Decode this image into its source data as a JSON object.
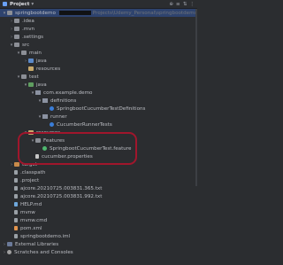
{
  "header": {
    "title": "Project",
    "chevron": "▾",
    "tools": [
      "⊕",
      "≡",
      "⇅",
      "⋮"
    ]
  },
  "project": {
    "root_name": "springbootdemo",
    "root_path": "Projects\\Udemy_Personal\\springbootdemo"
  },
  "tree": [
    {
      "id": "r0",
      "depth": 0,
      "arrow": "▾",
      "icon": "folder",
      "label": "springbootdemo",
      "color": "normal",
      "selected": true
    },
    {
      "id": "r1",
      "depth": 1,
      "arrow": "›",
      "icon": "folder",
      "label": ".idea",
      "color": "normal"
    },
    {
      "id": "r2",
      "depth": 1,
      "arrow": "›",
      "icon": "folder",
      "label": ".mvn",
      "color": "normal"
    },
    {
      "id": "r3",
      "depth": 1,
      "arrow": "›",
      "icon": "folder",
      "label": ".settings",
      "color": "normal"
    },
    {
      "id": "r4",
      "depth": 1,
      "arrow": "▾",
      "icon": "folder",
      "label": "src",
      "color": "normal"
    },
    {
      "id": "r5",
      "depth": 2,
      "arrow": "▾",
      "icon": "folder",
      "label": "main",
      "color": "normal"
    },
    {
      "id": "r6",
      "depth": 3,
      "arrow": "›",
      "icon": "folder src",
      "label": "java",
      "color": "normal"
    },
    {
      "id": "r7",
      "depth": 3,
      "arrow": "",
      "icon": "folder res",
      "label": "resources",
      "color": "normal"
    },
    {
      "id": "r8",
      "depth": 2,
      "arrow": "▾",
      "icon": "folder",
      "label": "test",
      "color": "normal"
    },
    {
      "id": "r9",
      "depth": 3,
      "arrow": "▾",
      "icon": "folder test",
      "label": "java",
      "color": "normal"
    },
    {
      "id": "r10",
      "depth": 4,
      "arrow": "▾",
      "icon": "pkg",
      "label": "com.example.demo",
      "color": "normal"
    },
    {
      "id": "r11",
      "depth": 5,
      "arrow": "▾",
      "icon": "pkg",
      "label": "definitions",
      "color": "normal"
    },
    {
      "id": "r12",
      "depth": 6,
      "arrow": "",
      "icon": "cls",
      "label": "SpringbootCucumberTestDefinitions",
      "color": "normal"
    },
    {
      "id": "r13",
      "depth": 5,
      "arrow": "▾",
      "icon": "pkg",
      "label": "runner",
      "color": "normal"
    },
    {
      "id": "r14",
      "depth": 6,
      "arrow": "",
      "icon": "cls",
      "label": "CucumberRunnerTests",
      "color": "normal"
    },
    {
      "id": "r15",
      "depth": 3,
      "arrow": "▾",
      "icon": "folder res",
      "label": "resources",
      "color": "normal"
    },
    {
      "id": "r16",
      "depth": 4,
      "arrow": "▾",
      "icon": "folder",
      "label": "Features",
      "color": "normal"
    },
    {
      "id": "r17",
      "depth": 5,
      "arrow": "",
      "icon": "feat",
      "label": "SpringbootCucumberTest.feature",
      "color": "normal"
    },
    {
      "id": "r18",
      "depth": 4,
      "arrow": "",
      "icon": "props",
      "label": "cucumber.properties",
      "color": "normal"
    },
    {
      "id": "r19",
      "depth": 1,
      "arrow": "›",
      "icon": "folder excl",
      "label": "target",
      "color": "normal"
    },
    {
      "id": "r20",
      "depth": 1,
      "arrow": "",
      "icon": "file",
      "label": ".classpath",
      "color": "normal"
    },
    {
      "id": "r21",
      "depth": 1,
      "arrow": "",
      "icon": "file",
      "label": ".project",
      "color": "normal"
    },
    {
      "id": "r22",
      "depth": 1,
      "arrow": "",
      "icon": "file",
      "label": "ajcore.20210725.003831.365.txt",
      "color": "normal"
    },
    {
      "id": "r23",
      "depth": 1,
      "arrow": "",
      "icon": "file",
      "label": "ajcore.20210725.003831.992.txt",
      "color": "normal"
    },
    {
      "id": "r24",
      "depth": 1,
      "arrow": "",
      "icon": "md",
      "label": "HELP.md",
      "color": "normal"
    },
    {
      "id": "r25",
      "depth": 1,
      "arrow": "",
      "icon": "file",
      "label": "mvnw",
      "color": "normal"
    },
    {
      "id": "r26",
      "depth": 1,
      "arrow": "",
      "icon": "file",
      "label": "mvnw.cmd",
      "color": "normal"
    },
    {
      "id": "r27",
      "depth": 1,
      "arrow": "",
      "icon": "xml",
      "label": "pom.xml",
      "color": "normal"
    },
    {
      "id": "r28",
      "depth": 1,
      "arrow": "",
      "icon": "file",
      "label": "springbootdemo.iml",
      "color": "normal"
    },
    {
      "id": "r29",
      "depth": 0,
      "arrow": "›",
      "icon": "lib",
      "label": "External Libraries",
      "color": "normal"
    },
    {
      "id": "r30",
      "depth": 0,
      "arrow": "›",
      "icon": "scratch",
      "label": "Scratches and Consoles",
      "color": "normal"
    }
  ]
}
